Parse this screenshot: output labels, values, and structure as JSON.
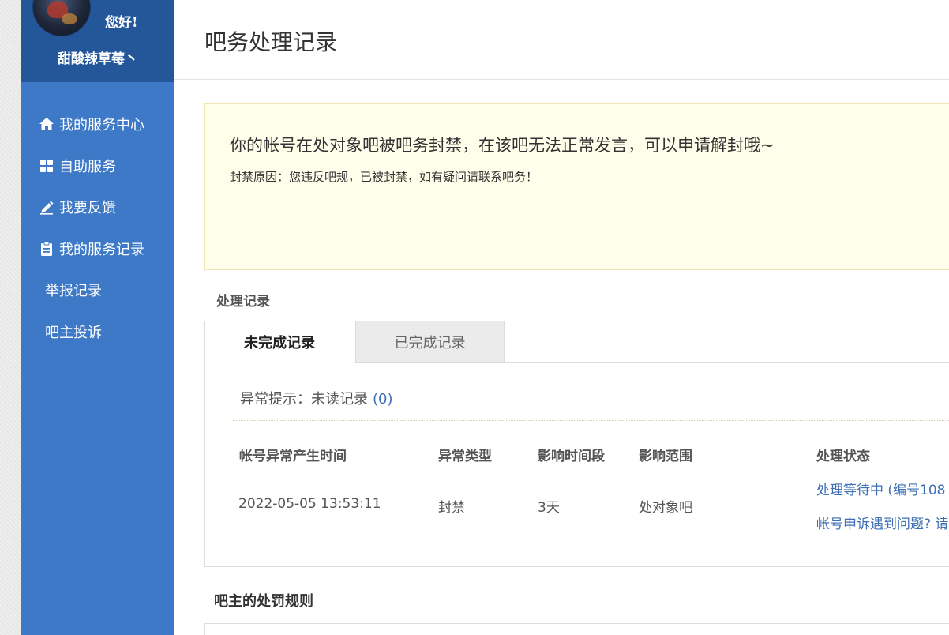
{
  "sidebar": {
    "greeting": "您好!",
    "username": "甜酸辣草莓丶",
    "items": [
      {
        "label": "我的服务中心",
        "icon": "home-icon"
      },
      {
        "label": "自助服务",
        "icon": "grid-icon"
      },
      {
        "label": "我要反馈",
        "icon": "edit-icon"
      },
      {
        "label": "我的服务记录",
        "icon": "clipboard-icon"
      },
      {
        "label": "举报记录"
      },
      {
        "label": "吧主投诉"
      }
    ]
  },
  "header": {
    "title": "吧务处理记录"
  },
  "notice": {
    "title": "你的帐号在处对象吧被吧务封禁，在该吧无法正常发言，可以申请解封哦~",
    "reason": "封禁原因：您违反吧规，已被封禁，如有疑问请联系吧务！"
  },
  "records": {
    "section_label": "处理记录",
    "tabs": [
      "未完成记录",
      "已完成记录"
    ],
    "abnormal_tip": "异常提示：未读记录",
    "unread_count": "(0)",
    "columns": [
      "帐号异常产生时间",
      "异常类型",
      "影响时间段",
      "影响范围",
      "处理状态"
    ],
    "rows": [
      {
        "time": "2022-05-05 13:53:11",
        "type": "封禁",
        "duration": "3天",
        "scope": "处对象吧",
        "status": "处理等待中 (编号108",
        "appeal_link": "帐号申诉遇到问题? 请"
      }
    ]
  },
  "rules": {
    "title": "吧主的处罚规则"
  },
  "colors": {
    "sidebar": "#3e79c7",
    "sidebar_user": "#24569a",
    "link": "#3e6fb4",
    "notice_bg": "#fefeea"
  }
}
